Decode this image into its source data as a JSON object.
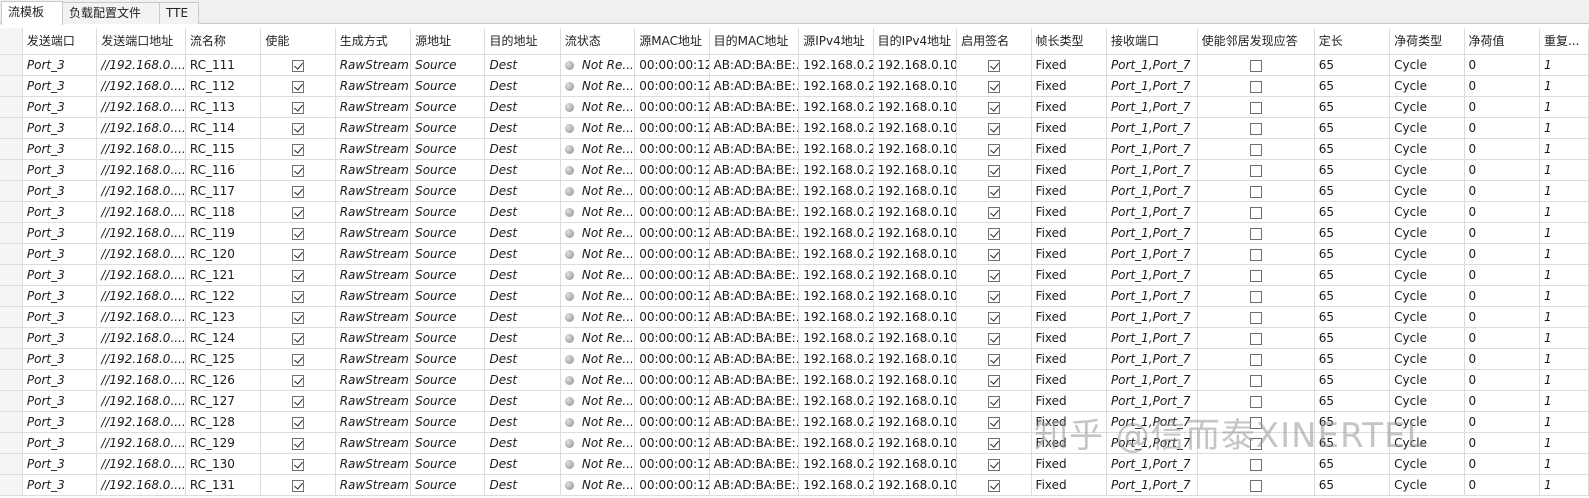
{
  "tabs": [
    {
      "label": "流模板",
      "active": true
    },
    {
      "label": "负载配置文件",
      "active": false
    },
    {
      "label": "TTE",
      "active": false
    }
  ],
  "columns": [
    "发送端口",
    "发送端口地址",
    "流名称",
    "使能",
    "生成方式",
    "源地址",
    "目的地址",
    "流状态",
    "源MAC地址",
    "目的MAC地址",
    "源IPv4地址",
    "目的IPv4地址",
    "启用签名",
    "帧长类型",
    "接收端口",
    "使能邻居发现应答",
    "定长",
    "净荷类型",
    "净荷值",
    "重复..."
  ],
  "row_template": {
    "port": "Port_3",
    "port_addr": "//192.168.0....",
    "enabled": true,
    "gen_mode": "RawStream",
    "src": "Source",
    "dst": "Dest",
    "status": "Not Re...",
    "src_mac": "00:00:00:12...",
    "dst_mac": "AB:AD:BA:BE:...",
    "src_ip": "192.168.0.2",
    "dst_ip": "192.168.0.10",
    "sign": true,
    "frame_len_type": "Fixed",
    "rx_ports": "Port_1,Port_7",
    "neighbor_reply": false,
    "fixed_len": "65",
    "payload_type": "Cycle",
    "payload_value": "0",
    "repeat": "1"
  },
  "rows": [
    "RC_111",
    "RC_112",
    "RC_113",
    "RC_114",
    "RC_115",
    "RC_116",
    "RC_117",
    "RC_118",
    "RC_119",
    "RC_120",
    "RC_121",
    "RC_122",
    "RC_123",
    "RC_124",
    "RC_125",
    "RC_126",
    "RC_127",
    "RC_128",
    "RC_129",
    "RC_130",
    "RC_131"
  ],
  "watermark": "知乎 @信而泰XINERTEL"
}
